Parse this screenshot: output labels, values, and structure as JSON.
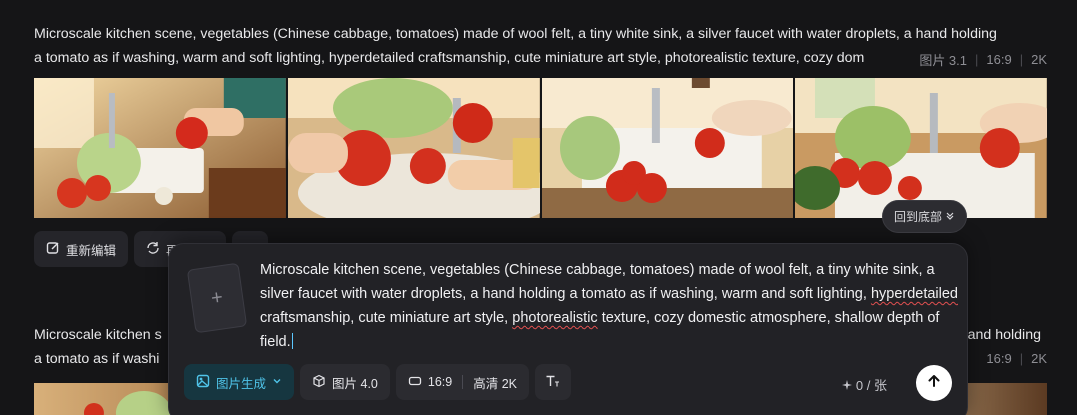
{
  "feed": {
    "item1": {
      "prompt_line1": "Microscale kitchen scene, vegetables (Chinese cabbage, tomatoes) made of wool felt, a tiny white sink, a silver faucet with water droplets, a hand holding",
      "prompt_line2": "a tomato as if washing, warm and soft lighting, hyperdetailed craftsmanship, cute miniature art style, photorealistic texture, cozy dom",
      "model": "图片 3.1",
      "ratio": "16:9",
      "resolution": "2K"
    },
    "actions": {
      "edit_label": "重新编辑",
      "regen_label": "再"
    },
    "item2": {
      "prompt_line1_left": "Microscale kitchen s",
      "prompt_line1_right": "and holding",
      "prompt_line2_left": "a tomato as if washi",
      "ratio": "16:9",
      "resolution": "2K"
    }
  },
  "scroll_bottom_label": "回到底部",
  "composer": {
    "upload_icon": "+",
    "prompt": {
      "p1": "Microscale kitchen scene, vegetables (Chinese cabbage, tomatoes) made of wool felt, a tiny white sink, a silver faucet with water droplets, a hand holding a tomato as if washing, warm and soft lighting, ",
      "w1": "hyperdetailed",
      "p2": " craftsmanship, cute miniature art style, ",
      "w2": "photorealistic",
      "p3": " texture, cozy domestic atmosphere, shallow depth of field."
    },
    "mode_label": "图片生成",
    "model_label": "图片 4.0",
    "ratio_label": "16:9",
    "quality_label": "高清 2K",
    "quota": "0 / 张"
  },
  "colors": {
    "background": "#151517",
    "accent": "#4fc3e8",
    "panel": "#222226"
  }
}
